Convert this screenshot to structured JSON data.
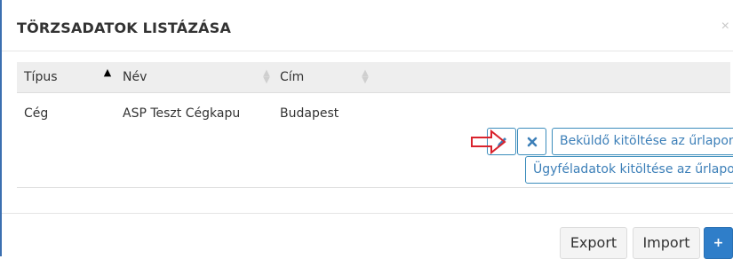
{
  "modal": {
    "title": "TÖRZSADATOK LISTÁZÁSA",
    "close_glyph": "×"
  },
  "table": {
    "columns": [
      {
        "label": "Típus",
        "sort": "ascending"
      },
      {
        "label": "Név",
        "sort": "none"
      },
      {
        "label": "Cím",
        "sort": "none"
      }
    ],
    "rows": [
      {
        "tipus": "Cég",
        "nev": "ASP Teszt Cégkapu",
        "cim": "Budapest",
        "actions": {
          "edit_icon": "pencil-icon",
          "delete_icon": "times-icon",
          "bekuldo_label": "Beküldő kitöltése az űrlapon",
          "ugyfel_label": "Ügyféladatok kitöltése az űrlapon"
        }
      }
    ]
  },
  "annotation": {
    "arrow_color": "#d9232d"
  },
  "footer": {
    "export_label": "Export",
    "import_label": "Import",
    "add_label": "+"
  },
  "colors": {
    "accent": "#3c8dbc",
    "primary": "#2f7ec9"
  }
}
